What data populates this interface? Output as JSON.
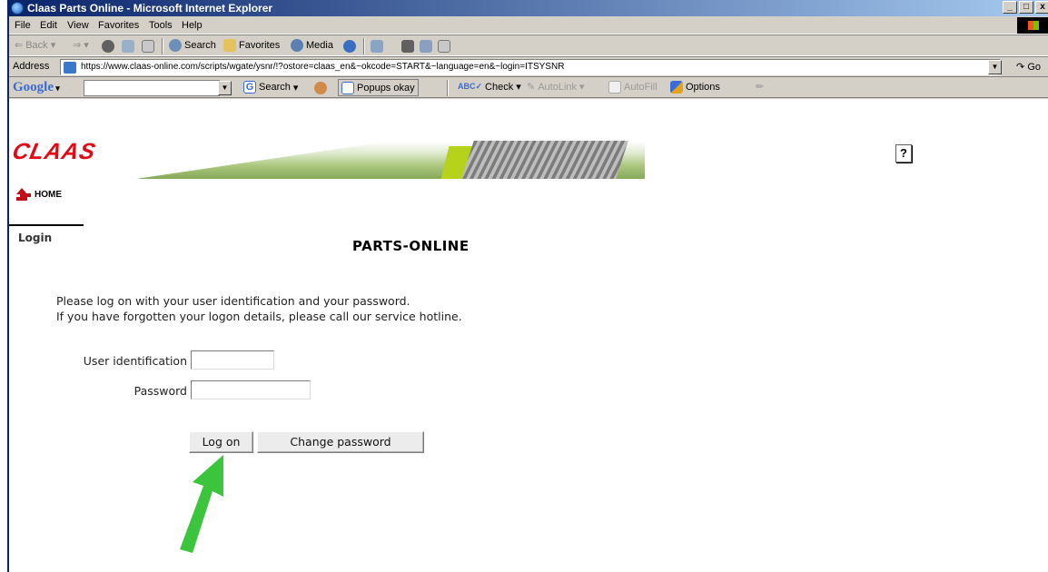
{
  "window": {
    "title": "Claas Parts Online - Microsoft Internet Explorer",
    "controls": {
      "minimize": "_",
      "maximize": "□",
      "close": "x"
    }
  },
  "menu": [
    "File",
    "Edit",
    "View",
    "Favorites",
    "Tools",
    "Help"
  ],
  "toolbar": {
    "back": "Back",
    "search": "Search",
    "favorites": "Favorites",
    "media": "Media"
  },
  "address": {
    "label": "Address",
    "url": "https://www.claas-online.com/scripts/wgate/ysnr/!?ostore=claas_en&~okcode=START&~language=en&~login=ITSYSNR",
    "go": "Go"
  },
  "google_toolbar": {
    "logo": "Google",
    "search": "Search",
    "popups": "Popups okay",
    "check": "Check",
    "autolink": "AutoLink",
    "autofill": "AutoFill",
    "options": "Options"
  },
  "page": {
    "logo": "CLAAS",
    "help": "?",
    "home": "HOME",
    "login_tab": "Login",
    "title": "PARTS-ONLINE",
    "intro_line1": "Please log on with your user identification and your password.",
    "intro_line2": "If you have forgotten your logon details, please call our service hotline.",
    "user_label": "User identification",
    "user_value": "",
    "password_label": "Password",
    "password_value": "",
    "logon_button": "Log on",
    "change_password_button": "Change password"
  },
  "colors": {
    "brand_red": "#e40613",
    "title_bar": "#0a246a",
    "arrow_green": "#3cc43c"
  }
}
